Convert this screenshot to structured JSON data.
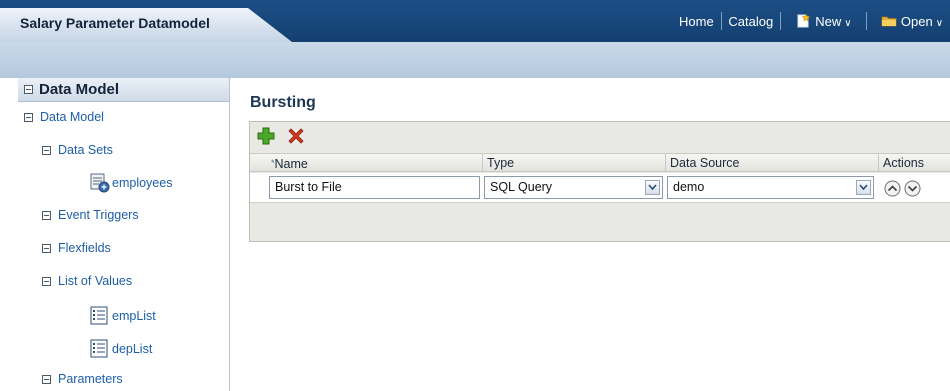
{
  "header": {
    "document_title": "Salary Parameter Datamodel",
    "menu": {
      "home": "Home",
      "catalog": "Catalog",
      "new": "New",
      "open": "Open"
    }
  },
  "nav": {
    "panel_title": "Data Model",
    "items": [
      {
        "label": "Data Model",
        "icon": "collapse-box"
      },
      {
        "label": "Data Sets",
        "icon": "collapse-box"
      },
      {
        "label": "employees",
        "icon": "dataset-icon"
      },
      {
        "label": "Event Triggers",
        "icon": "collapse-box"
      },
      {
        "label": "Flexfields",
        "icon": "collapse-box"
      },
      {
        "label": "List of Values",
        "icon": "collapse-box"
      },
      {
        "label": "empList",
        "icon": "list-icon"
      },
      {
        "label": "depList",
        "icon": "list-icon"
      },
      {
        "label": "Parameters",
        "icon": "collapse-box"
      }
    ]
  },
  "main": {
    "title": "Bursting",
    "toolbar": {
      "add_icon": "plus-icon",
      "delete_icon": "x-icon"
    },
    "columns": {
      "required_marker": "*",
      "name": "Name",
      "type": "Type",
      "data_source": "Data Source",
      "actions": "Actions"
    },
    "rows": [
      {
        "name": "Burst to File",
        "type": "SQL Query",
        "data_source": "demo"
      }
    ]
  },
  "colors": {
    "header_bg": "#1c4f86",
    "link": "#1d5ea8",
    "add_green": "#3a9a1e",
    "delete_red": "#d13a1c"
  }
}
